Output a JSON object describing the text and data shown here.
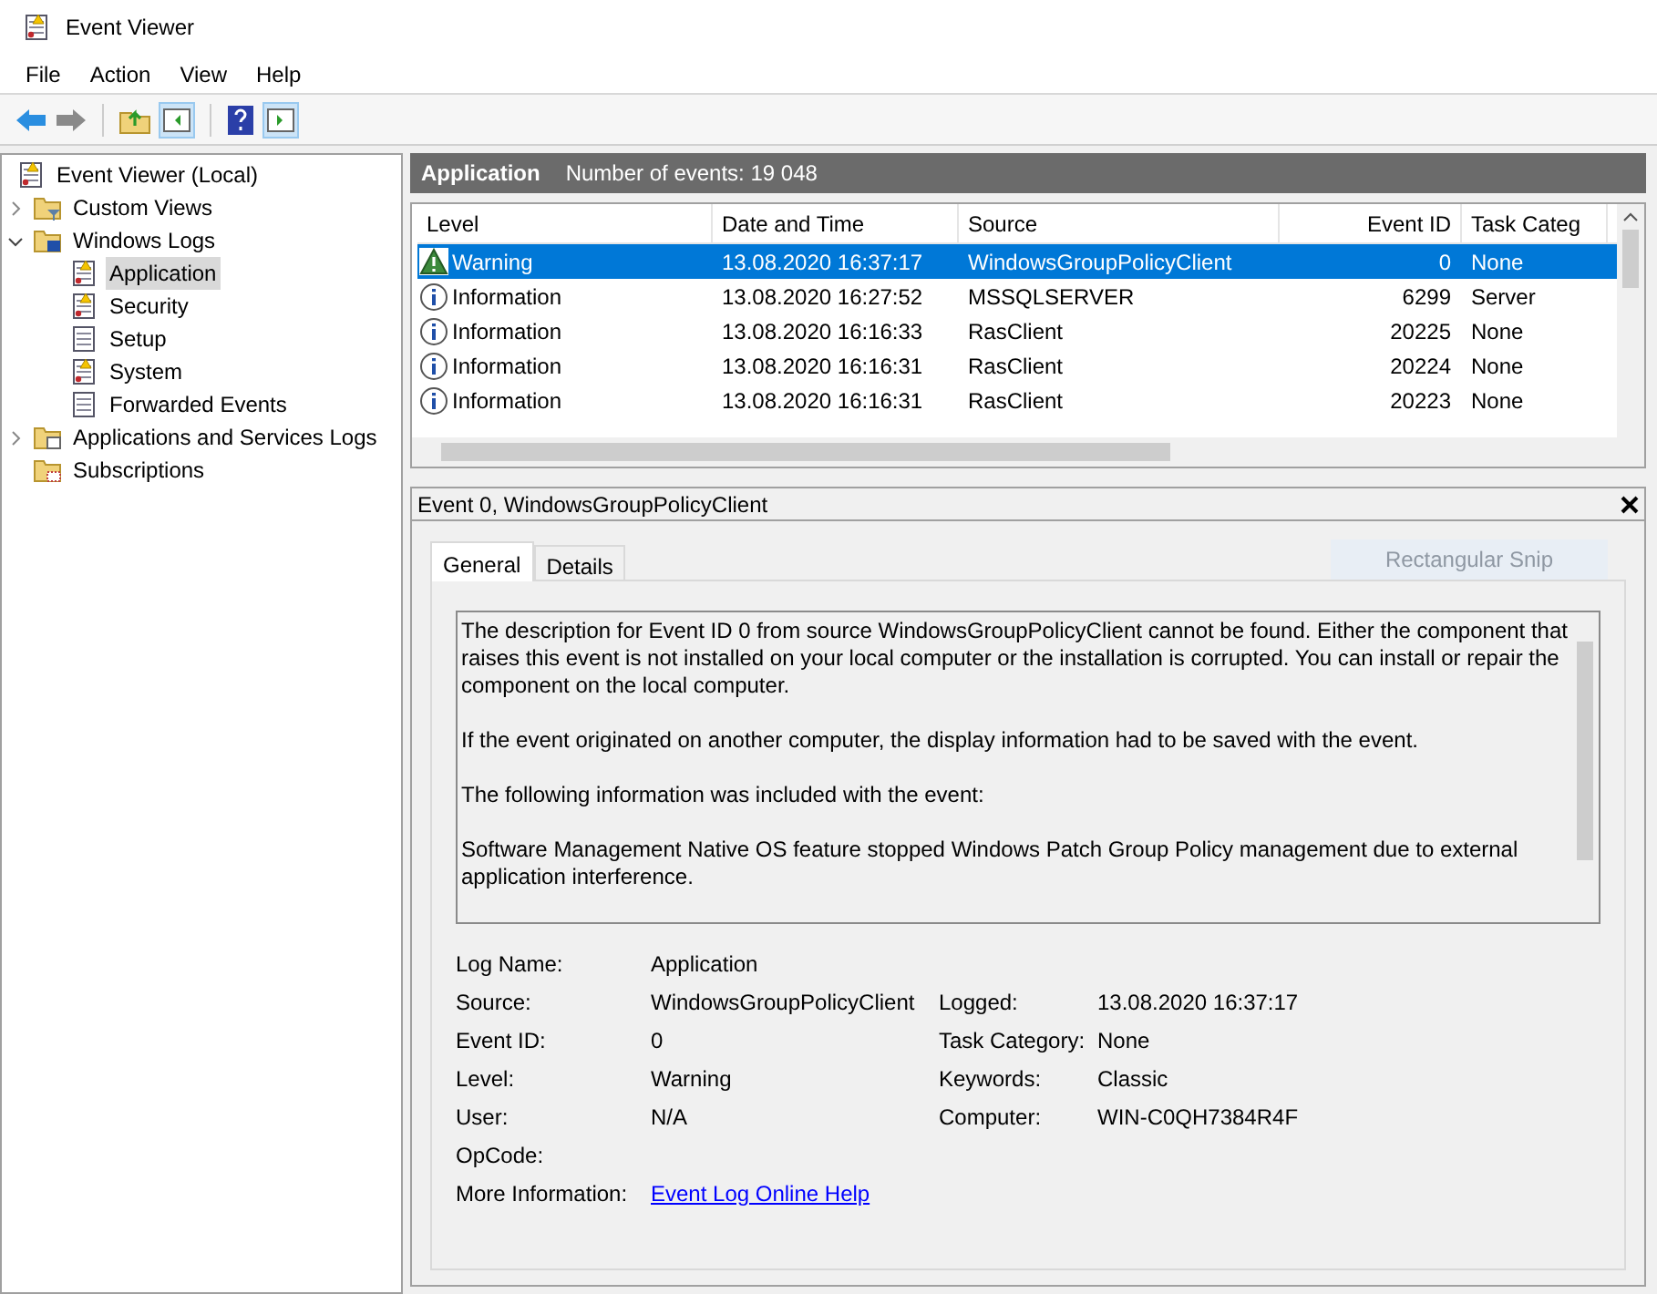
{
  "window": {
    "title": "Event Viewer"
  },
  "menu": [
    "File",
    "Action",
    "View",
    "Help"
  ],
  "tree": [
    {
      "label": "Event Viewer (Local)",
      "kind": "root",
      "selected": false,
      "children": [
        {
          "label": "Custom Views",
          "kind": "filter-folder",
          "expanded": false,
          "selected": false
        },
        {
          "label": "Windows Logs",
          "kind": "logs-folder",
          "expanded": true,
          "selected": false,
          "children": [
            {
              "label": "Application",
              "kind": "warn-log",
              "selected": true
            },
            {
              "label": "Security",
              "kind": "warn-log",
              "selected": false
            },
            {
              "label": "Setup",
              "kind": "log",
              "selected": false
            },
            {
              "label": "System",
              "kind": "warn-log",
              "selected": false
            },
            {
              "label": "Forwarded Events",
              "kind": "log",
              "selected": false
            }
          ]
        },
        {
          "label": "Applications and Services Logs",
          "kind": "folder",
          "expanded": false,
          "selected": false
        },
        {
          "label": "Subscriptions",
          "kind": "subs",
          "selected": false
        }
      ]
    }
  ],
  "log_header": {
    "title": "Application",
    "count": "Number of events: 19 048"
  },
  "table": {
    "columns": [
      "Level",
      "Date and Time",
      "Source",
      "Event ID",
      "Task Categ"
    ],
    "rows": [
      {
        "kind": "warning",
        "selected": true,
        "cells": [
          "Warning",
          "13.08.2020 16:37:17",
          "WindowsGroupPolicyClient",
          "0",
          "None"
        ]
      },
      {
        "kind": "information",
        "selected": false,
        "cells": [
          "Information",
          "13.08.2020 16:27:52",
          "MSSQLSERVER",
          "6299",
          "Server"
        ]
      },
      {
        "kind": "information",
        "selected": false,
        "cells": [
          "Information",
          "13.08.2020 16:16:33",
          "RasClient",
          "20225",
          "None"
        ]
      },
      {
        "kind": "information",
        "selected": false,
        "cells": [
          "Information",
          "13.08.2020 16:16:31",
          "RasClient",
          "20224",
          "None"
        ]
      },
      {
        "kind": "information",
        "selected": false,
        "cells": [
          "Information",
          "13.08.2020 16:16:31",
          "RasClient",
          "20223",
          "None"
        ]
      }
    ]
  },
  "detail": {
    "title": "Event 0, WindowsGroupPolicyClient",
    "tabs": [
      {
        "label": "General",
        "selected": true
      },
      {
        "label": "Details",
        "selected": false
      }
    ],
    "overlay": "Rectangular Snip",
    "description": [
      "The description for Event ID 0 from source WindowsGroupPolicyClient cannot be found. Either the component that raises this event is not installed on your local computer or the installation is corrupted. You can install or repair the component on the local computer.",
      "If the event originated on another computer, the display information had to be saved with the event.",
      "The following information was included with the event:",
      "Software Management Native OS feature stopped Windows Patch Group Policy management due to external application interference."
    ],
    "fields": [
      {
        "label": "Log Name:",
        "value": "Application"
      },
      {
        "label": "Source:",
        "value": "WindowsGroupPolicyClient",
        "label_2": "Logged:",
        "value_2": "13.08.2020 16:37:17"
      },
      {
        "label": "Event ID:",
        "value": "0",
        "label_2": "Task Category:",
        "value_2": "None"
      },
      {
        "label": "Level:",
        "value": "Warning",
        "label_2": "Keywords:",
        "value_2": "Classic"
      },
      {
        "label": "User:",
        "value": "N/A",
        "label_2": "Computer:",
        "value_2": "WIN-C0QH7384R4F"
      },
      {
        "label": "OpCode:"
      },
      {
        "label": "More Information:",
        "link": "Event Log Online Help"
      }
    ]
  }
}
